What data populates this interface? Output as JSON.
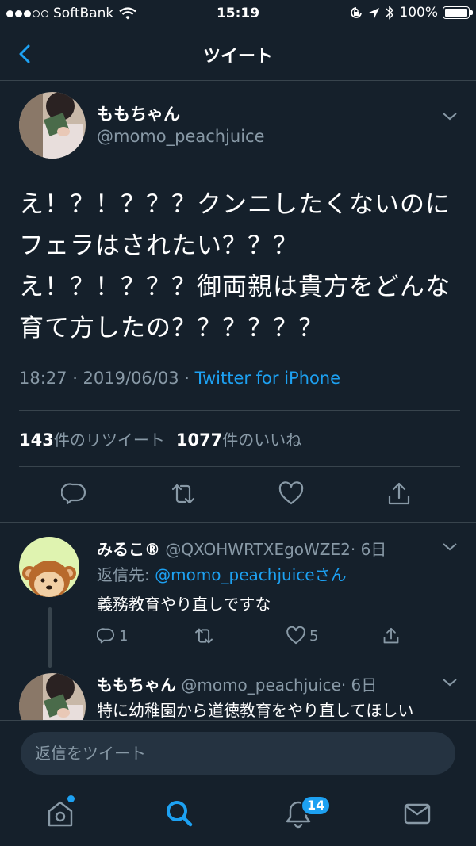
{
  "status_bar": {
    "carrier": "SoftBank",
    "time": "15:19",
    "battery": "100%"
  },
  "header": {
    "title": "ツイート"
  },
  "tweet": {
    "name": "ももちゃん",
    "handle": "@momo_peachjuice",
    "text": "え！？！？？？クンニしたくないのにフェラはされたい？？？え！？！？？？御両親は貴方をどんな育て方したの？？？？？？",
    "time": "18:27 · 2019/06/03 · ",
    "source": "Twitter for iPhone",
    "retweets_count": "143",
    "retweets_label": "件のリツイート",
    "likes_count": "1077",
    "likes_label": "件のいいね"
  },
  "reply1": {
    "name": "みるこ®",
    "handle": "@QXOHWRTXEgoWZE2",
    "age": "· 6日",
    "reply_to_prefix": "返信先: ",
    "reply_to_handle": "@momo_peachjuice",
    "reply_to_suffix": "さん",
    "text": "義務教育やり直しですな",
    "reply_count": "1",
    "like_count": "5"
  },
  "reply2": {
    "name": "ももちゃん",
    "handle": "@momo_peachjuice",
    "age": "· 6日",
    "text": "特に幼稚園から道徳教育をやり直してほしい"
  },
  "compose": {
    "placeholder": "返信をツイート"
  },
  "tabbar": {
    "notifications_badge": "14"
  },
  "colors": {
    "background": "#15202b",
    "accent": "#1da1f2",
    "muted": "#8899a6",
    "divider": "#38444d"
  }
}
